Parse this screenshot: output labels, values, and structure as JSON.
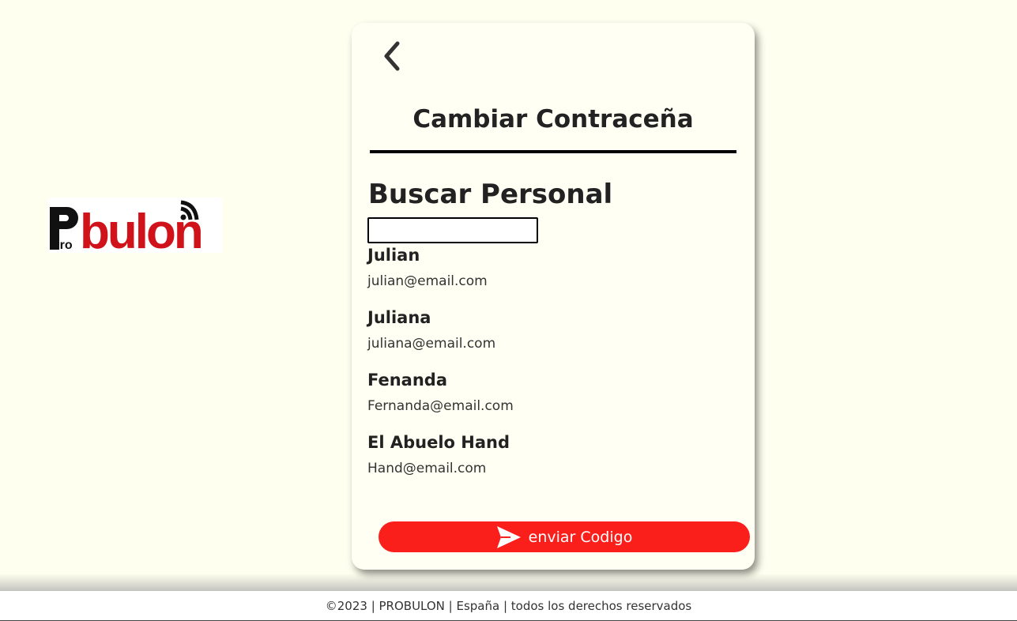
{
  "brand": {
    "logo_text_prefix": "Pro",
    "logo_text_main": "bulon",
    "brand_color": "#d0121b"
  },
  "card": {
    "back_icon": "chevron-left-icon",
    "title": "Cambiar Contraceña",
    "section_title": "Buscar Personal",
    "search": {
      "value": "",
      "placeholder": ""
    },
    "people": [
      {
        "name": "Julian",
        "email": "julian@email.com"
      },
      {
        "name": "Juliana",
        "email": "juliana@email.com"
      },
      {
        "name": "Fenanda",
        "email": "Fernanda@email.com"
      },
      {
        "name": "El Abuelo Hand",
        "email": "Hand@email.com"
      }
    ],
    "send_button": {
      "label": "enviar Codigo",
      "icon": "send-icon",
      "color": "#fb1f1c"
    }
  },
  "footer": {
    "text": "©2023 | PROBULON | España | todos los derechos reservados"
  },
  "colors": {
    "background": "#fffff0",
    "card_background": "#fffff3"
  }
}
